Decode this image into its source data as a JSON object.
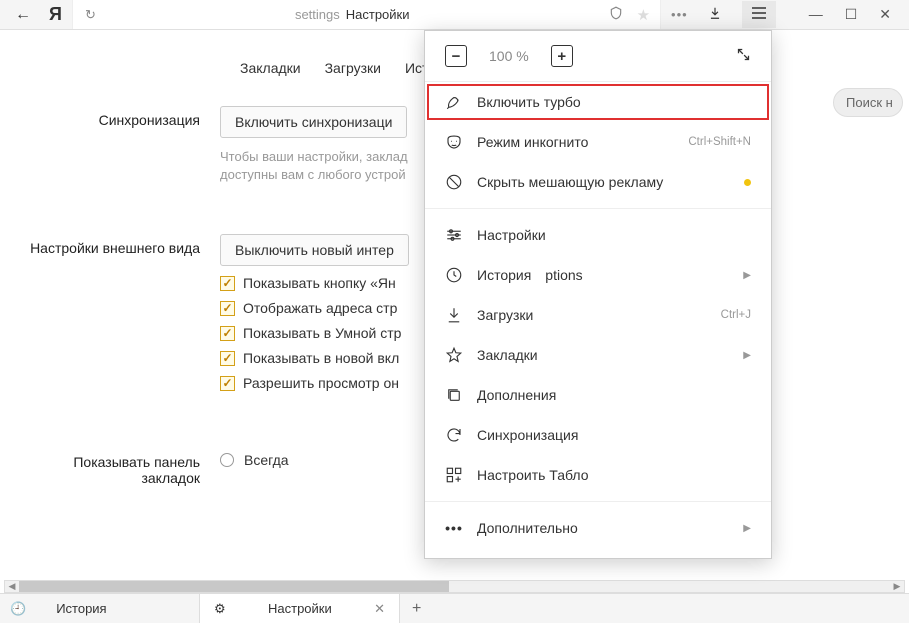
{
  "titlebar": {
    "address_path": "settings",
    "address_title": "Настройки"
  },
  "tabs": {
    "bookmarks": "Закладки",
    "downloads": "Загрузки",
    "history": "Исто"
  },
  "search_placeholder": "Поиск н",
  "sync": {
    "label": "Синхронизация",
    "button": "Включить синхронизаци",
    "hint": "Чтобы ваши настройки, заклад\nдоступны вам с любого устрой"
  },
  "appearance": {
    "label": "Настройки внешнего вида",
    "button": "Выключить новый интер",
    "checks": [
      "Показывать кнопку «Ян",
      "Отображать адреса стр",
      "Показывать в Умной стр",
      "Показывать в новой вкл",
      "Разрешить просмотр он"
    ]
  },
  "bookmarks_panel": {
    "label": "Показывать панель закладок",
    "option": "Всегда"
  },
  "dropdown": {
    "zoom": "100 %",
    "turbo": "Включить турбо",
    "incognito": "Режим инкогнито",
    "incognito_shortcut": "Ctrl+Shift+N",
    "adblock": "Скрыть мешающую рекламу",
    "settings": "Настройки",
    "history": "История",
    "downloads": "Загрузки",
    "downloads_shortcut": "Ctrl+J",
    "bookmarks": "Закладки",
    "addons": "Дополнения",
    "sync": "Синхронизация",
    "tablo": "Настроить Табло",
    "more": "Дополнительно"
  },
  "bottombar": {
    "history": "История",
    "settings": "Настройки"
  }
}
